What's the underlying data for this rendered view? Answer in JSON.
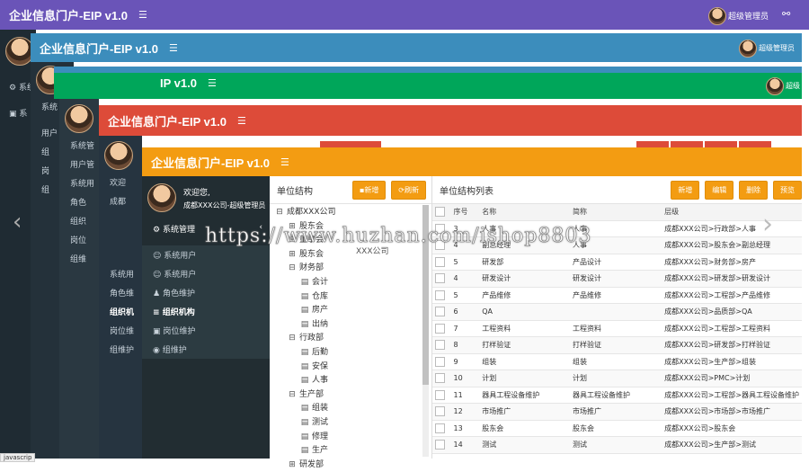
{
  "app_title": "企业信息门户-EIP v1.0",
  "app_title_short": "IP v1.0",
  "admin_label": "超级管理员",
  "admin_label_short": "超级",
  "welcome": "欢迎您,",
  "user_line": "成都XXX公司-超级管理员",
  "welcome_short": "欢迎",
  "user_short": "成都",
  "menu": {
    "system": "系统管理",
    "system_short": "系统",
    "system_short2": "系统管",
    "user_mgmt": "用户管",
    "user_short": "用户",
    "items": [
      "系统用户",
      "系统用户",
      "角色维护",
      "组织机构",
      "岗位维护",
      "组维护"
    ],
    "item_short": [
      "系统用",
      "角色",
      "组织",
      "岗位",
      "组维"
    ],
    "item_short2": [
      "系统用",
      "角色维",
      "组织机",
      "岗位维",
      "组维护"
    ],
    "frag": [
      "系",
      "组",
      "岗",
      "组"
    ]
  },
  "tree_panel": {
    "title": "单位结构",
    "add_label": "新增",
    "refresh_label": "刷新",
    "nodes": [
      {
        "label": "成都XXX公司",
        "level": 0,
        "type": "folder-open"
      },
      {
        "label": "股东会",
        "level": 1,
        "type": "folder"
      },
      {
        "label": "董事会",
        "level": 1,
        "type": "folder"
      },
      {
        "label": "股东会",
        "level": 1,
        "type": "folder"
      },
      {
        "label": "财务部",
        "level": 1,
        "type": "folder-open"
      },
      {
        "label": "会计",
        "level": 2,
        "type": "file"
      },
      {
        "label": "仓库",
        "level": 2,
        "type": "file"
      },
      {
        "label": "房产",
        "level": 2,
        "type": "file"
      },
      {
        "label": "出纳",
        "level": 2,
        "type": "file"
      },
      {
        "label": "行政部",
        "level": 1,
        "type": "folder-open"
      },
      {
        "label": "后勤",
        "level": 2,
        "type": "file"
      },
      {
        "label": "安保",
        "level": 2,
        "type": "file"
      },
      {
        "label": "人事",
        "level": 2,
        "type": "file"
      },
      {
        "label": "生产部",
        "level": 1,
        "type": "folder-open"
      },
      {
        "label": "组装",
        "level": 2,
        "type": "file"
      },
      {
        "label": "测试",
        "level": 2,
        "type": "file"
      },
      {
        "label": "修理",
        "level": 2,
        "type": "file"
      },
      {
        "label": "生产",
        "level": 2,
        "type": "file"
      },
      {
        "label": "研发部",
        "level": 1,
        "type": "folder"
      }
    ],
    "overlay_text": "XXX公司"
  },
  "list_panel": {
    "title": "单位结构列表",
    "buttons": [
      "新增",
      "编辑",
      "删除",
      "预览"
    ],
    "columns": [
      "序号",
      "名称",
      "简称",
      "层级"
    ],
    "rows": [
      [
        "3",
        "人事",
        "人事",
        "成都XXX公司>行政部>人事"
      ],
      [
        "4",
        "副总经理",
        "人事",
        "成都XXX公司>股东会>副总经理"
      ],
      [
        "5",
        "研发部",
        "产品设计",
        "成都XXX公司>财务部>房产"
      ],
      [
        "4",
        "研发设计",
        "研发设计",
        "成都XXX公司>研发部>研发设计"
      ],
      [
        "5",
        "产品维修",
        "产品维修",
        "成都XXX公司>工程部>产品维修"
      ],
      [
        "6",
        "QA",
        "",
        "成都XXX公司>品质部>QA"
      ],
      [
        "7",
        "工程资料",
        "工程资料",
        "成都XXX公司>工程部>工程资料"
      ],
      [
        "8",
        "打样验证",
        "打样验证",
        "成都XXX公司>研发部>打样验证"
      ],
      [
        "9",
        "组装",
        "组装",
        "成都XXX公司>生产部>组装"
      ],
      [
        "10",
        "计划",
        "计划",
        "成都XXX公司>PMC>计划"
      ],
      [
        "11",
        "器具工程设备维护",
        "器具工程设备维护",
        "成都XXX公司>工程部>器具工程设备维护"
      ],
      [
        "12",
        "市场推广",
        "市场推广",
        "成都XXX公司>市场部>市场推广"
      ],
      [
        "13",
        "股东会",
        "股东会",
        "成都XXX公司>股东会"
      ],
      [
        "14",
        "测试",
        "测试",
        "成都XXX公司>生产部>测试"
      ]
    ]
  },
  "watermark": "https://www.huzhan.com/ishop8803",
  "status_text": "javascrip",
  "colors": {
    "purple": "#6a54b8",
    "blue": "#3c8dbc",
    "green": "#00a65a",
    "red": "#dd4b39",
    "orange": "#f39c12",
    "sidebar": "#1f2b33"
  }
}
